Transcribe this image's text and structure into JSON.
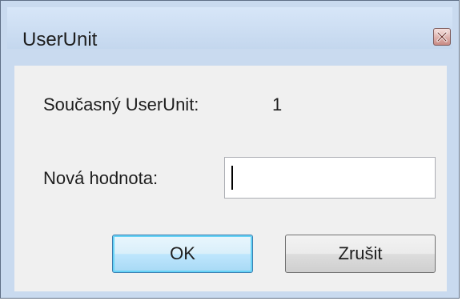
{
  "window": {
    "title": "UserUnit",
    "close_icon": "close-icon"
  },
  "content": {
    "current_label": "Současný UserUnit:",
    "current_value": "1",
    "new_label": "Nová hodnota:",
    "new_value": "",
    "new_placeholder": ""
  },
  "buttons": {
    "ok_label": "OK",
    "cancel_label": "Zrušit"
  },
  "colors": {
    "frame": "#c9daef",
    "client": "#f0f0f0",
    "ok_focus": "#67d3f6"
  }
}
